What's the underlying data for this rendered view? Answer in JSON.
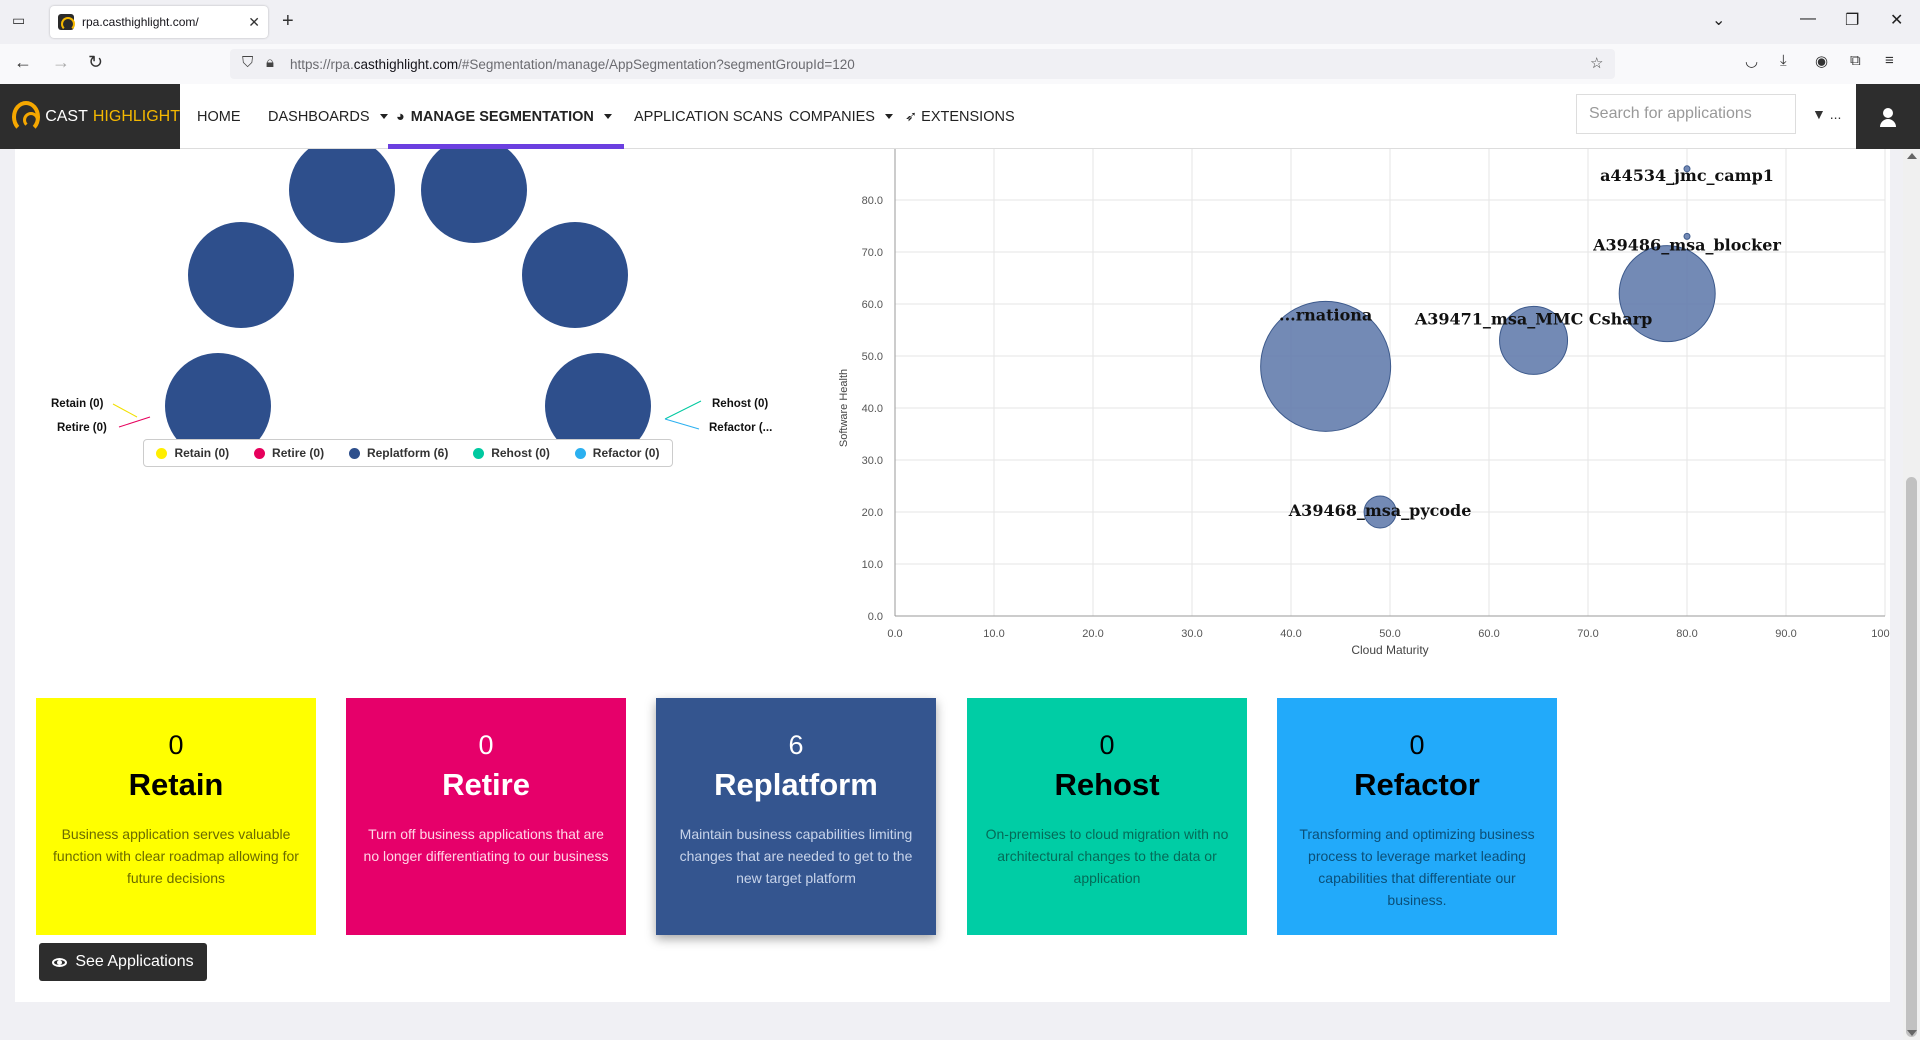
{
  "browser": {
    "tab_title": "rpa.casthighlight.com/",
    "url_prefix": "https://rpa.",
    "url_domain": "casthighlight.com",
    "url_suffix": "/#Segmentation/manage/AppSegmentation?segmentGroupId=120"
  },
  "header": {
    "logo_main": "CAST",
    "logo_accent": "HIGHLIGHT",
    "nav": [
      {
        "label": "HOME"
      },
      {
        "label": "DASHBOARDS"
      },
      {
        "label": "MANAGE SEGMENTATION"
      },
      {
        "label": "APPLICATION SCANS"
      },
      {
        "label": "COMPANIES"
      },
      {
        "label": "EXTENSIONS"
      }
    ],
    "search_placeholder": "Search for applications",
    "filter_suffix": "..."
  },
  "pie": {
    "labels_left": [
      "Retain (0)",
      "Retire (0)"
    ],
    "labels_right": [
      "Rehost (0)",
      "Refactor (..."
    ],
    "legend": [
      {
        "label": "Retain (0)",
        "color": "#ffee00"
      },
      {
        "label": "Retire (0)",
        "color": "#e6005c"
      },
      {
        "label": "Replatform (6)",
        "color": "#2e4f8c"
      },
      {
        "label": "Rehost (0)",
        "color": "#00c9a0"
      },
      {
        "label": "Refactor (0)",
        "color": "#2bb0f0"
      }
    ]
  },
  "chart_data": {
    "type": "scatter",
    "xlabel": "Cloud Maturity",
    "ylabel": "Software Health",
    "xlim": [
      0,
      100
    ],
    "ylim": [
      0,
      85
    ],
    "xticks": [
      "0.0",
      "10.0",
      "20.0",
      "30.0",
      "40.0",
      "50.0",
      "60.0",
      "70.0",
      "80.0",
      "90.0",
      "100.0"
    ],
    "yticks": [
      "0.0",
      "10.0",
      "20.0",
      "30.0",
      "40.0",
      "50.0",
      "60.0",
      "70.0",
      "80.0"
    ],
    "points": [
      {
        "label": "a44534_jmc_camp1",
        "x": 80.0,
        "y": 86.0,
        "size": 0.3
      },
      {
        "label": "A39486_msa_blocker",
        "x": 80.0,
        "y": 73.0,
        "size": 0.3
      },
      {
        "label": "A39486_msa_blocker",
        "x": 78.0,
        "y": 62.0,
        "size": 4.8
      },
      {
        "label": "A39471_msa_MMC Csharp",
        "x": 64.5,
        "y": 53.0,
        "size": 3.4
      },
      {
        "label": "...rnationa",
        "x": 43.5,
        "y": 48.0,
        "size": 6.5
      },
      {
        "label": "A39468_msa_pycode",
        "x": 49.0,
        "y": 20.0,
        "size": 1.6
      }
    ],
    "grid": true,
    "color": "#5a76a8"
  },
  "cards": [
    {
      "count": "0",
      "title": "Retain",
      "desc": "Business application serves valuable function with clear roadmap allowing for future decisions",
      "bg": "#ffff00",
      "fg": "#000000",
      "descColor": "#6b6b00"
    },
    {
      "count": "0",
      "title": "Retire",
      "desc": "Turn off business applications that are no longer differentiating to our business",
      "bg": "#e6006a",
      "fg": "#ffffff",
      "descColor": "#ffd6e6"
    },
    {
      "count": "6",
      "title": "Replatform",
      "desc": "Maintain business capabilities limiting changes that are needed to get to the new target platform",
      "bg": "#34558f",
      "fg": "#ffffff",
      "descColor": "#c8d4ea"
    },
    {
      "count": "0",
      "title": "Rehost",
      "desc": "On-premises to cloud migration with no architectural changes to the data or application",
      "bg": "#00cda5",
      "fg": "#000000",
      "descColor": "#046b58"
    },
    {
      "count": "0",
      "title": "Refactor",
      "desc": "Transforming and optimizing business process to leverage market leading capabilities that differentiate our business.",
      "bg": "#22aafa",
      "fg": "#000000",
      "descColor": "#0b4f78"
    }
  ],
  "actions": {
    "see_applications": "See Applications"
  }
}
